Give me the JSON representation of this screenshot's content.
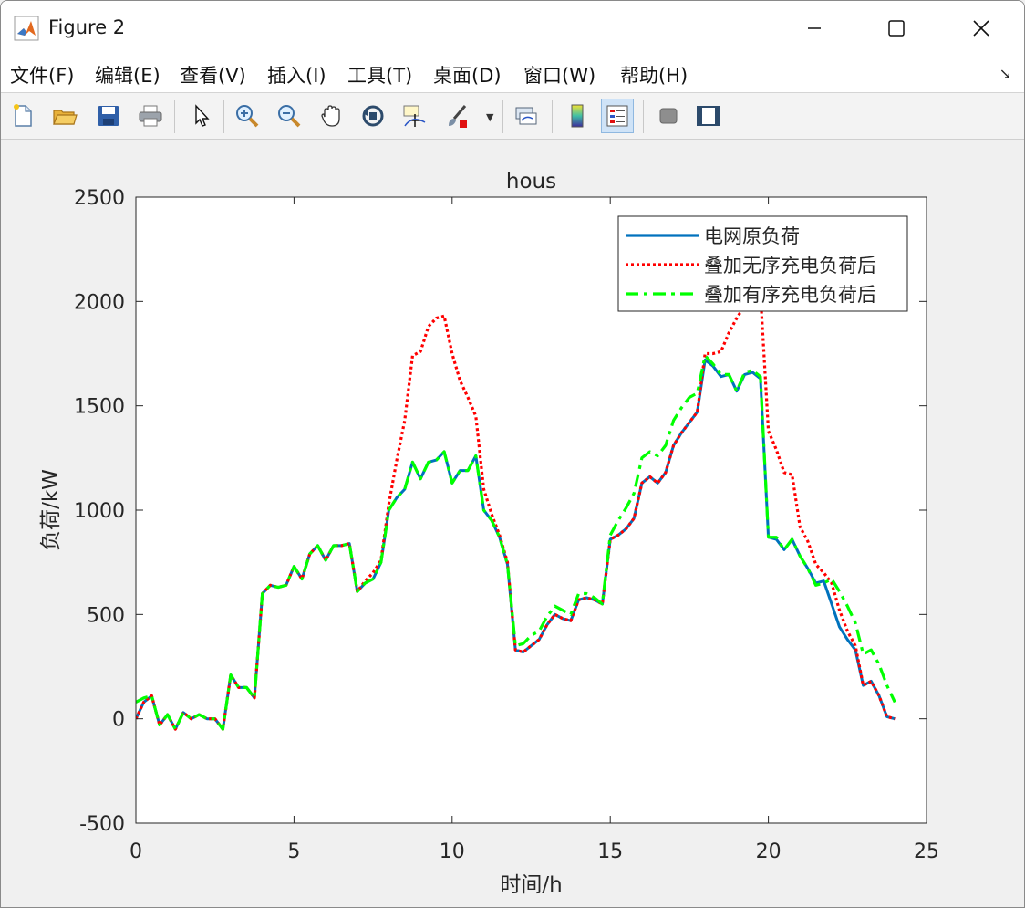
{
  "window": {
    "title": "Figure 2"
  },
  "menu": [
    "文件(F)",
    "编辑(E)",
    "查看(V)",
    "插入(I)",
    "工具(T)",
    "桌面(D)",
    "窗口(W)",
    "帮助(H)"
  ],
  "toolbar": [
    "new-file-icon",
    "open-folder-icon",
    "save-icon",
    "print-icon",
    "pointer-icon",
    "zoom-in-icon",
    "zoom-out-icon",
    "pan-hand-icon",
    "rotate-3d-icon",
    "data-cursor-icon",
    "brush-icon",
    "link-plot-icon",
    "colorbar-icon",
    "legend-icon",
    "hide-tools-icon",
    "dock-icon"
  ],
  "colors": {
    "series1": "#0072BD",
    "series2": "#FF0000",
    "series3": "#00FF00"
  },
  "chart_data": {
    "type": "line",
    "title": "hous",
    "xlabel": "时间/h",
    "ylabel": "负荷/kW",
    "xlim": [
      0,
      25
    ],
    "ylim": [
      -500,
      2500
    ],
    "xticks": [
      "0",
      "5",
      "10",
      "15",
      "20",
      "25"
    ],
    "yticks": [
      "-500",
      "0",
      "500",
      "1000",
      "1500",
      "2000",
      "2500"
    ],
    "grid": false,
    "legend_position": "top-right",
    "series": [
      {
        "name": "电网原负荷",
        "style": "solid",
        "points": [
          [
            0,
            0
          ],
          [
            0.25,
            80
          ],
          [
            0.5,
            110
          ],
          [
            0.75,
            -30
          ],
          [
            1,
            20
          ],
          [
            1.25,
            -50
          ],
          [
            1.5,
            30
          ],
          [
            1.75,
            0
          ],
          [
            2,
            20
          ],
          [
            2.25,
            0
          ],
          [
            2.5,
            0
          ],
          [
            2.75,
            -50
          ],
          [
            3,
            210
          ],
          [
            3.25,
            150
          ],
          [
            3.5,
            150
          ],
          [
            3.75,
            100
          ],
          [
            4,
            600
          ],
          [
            4.25,
            640
          ],
          [
            4.5,
            630
          ],
          [
            4.75,
            640
          ],
          [
            5,
            730
          ],
          [
            5.25,
            670
          ],
          [
            5.5,
            790
          ],
          [
            5.75,
            830
          ],
          [
            6,
            760
          ],
          [
            6.25,
            830
          ],
          [
            6.5,
            830
          ],
          [
            6.75,
            840
          ],
          [
            7,
            610
          ],
          [
            7.25,
            650
          ],
          [
            7.5,
            670
          ],
          [
            7.75,
            750
          ],
          [
            8,
            1000
          ],
          [
            8.25,
            1060
          ],
          [
            8.5,
            1100
          ],
          [
            8.75,
            1230
          ],
          [
            9,
            1150
          ],
          [
            9.25,
            1230
          ],
          [
            9.5,
            1240
          ],
          [
            9.75,
            1280
          ],
          [
            10,
            1130
          ],
          [
            10.25,
            1190
          ],
          [
            10.5,
            1190
          ],
          [
            10.75,
            1260
          ],
          [
            11,
            1000
          ],
          [
            11.25,
            950
          ],
          [
            11.5,
            870
          ],
          [
            11.75,
            740
          ],
          [
            12,
            330
          ],
          [
            12.25,
            320
          ],
          [
            12.5,
            350
          ],
          [
            12.75,
            380
          ],
          [
            13,
            450
          ],
          [
            13.25,
            500
          ],
          [
            13.5,
            480
          ],
          [
            13.75,
            470
          ],
          [
            14,
            570
          ],
          [
            14.25,
            580
          ],
          [
            14.5,
            570
          ],
          [
            14.75,
            550
          ],
          [
            15,
            860
          ],
          [
            15.25,
            880
          ],
          [
            15.5,
            910
          ],
          [
            15.75,
            960
          ],
          [
            16,
            1130
          ],
          [
            16.25,
            1160
          ],
          [
            16.5,
            1130
          ],
          [
            16.75,
            1180
          ],
          [
            17,
            1310
          ],
          [
            17.25,
            1370
          ],
          [
            17.5,
            1420
          ],
          [
            17.75,
            1470
          ],
          [
            18,
            1720
          ],
          [
            18.25,
            1690
          ],
          [
            18.5,
            1640
          ],
          [
            18.75,
            1650
          ],
          [
            19,
            1570
          ],
          [
            19.25,
            1650
          ],
          [
            19.5,
            1660
          ],
          [
            19.75,
            1630
          ],
          [
            20,
            870
          ],
          [
            20.25,
            860
          ],
          [
            20.5,
            810
          ],
          [
            20.75,
            860
          ],
          [
            21,
            780
          ],
          [
            21.25,
            720
          ],
          [
            21.5,
            650
          ],
          [
            21.75,
            660
          ],
          [
            22,
            550
          ],
          [
            22.25,
            440
          ],
          [
            22.5,
            380
          ],
          [
            22.75,
            330
          ],
          [
            23,
            160
          ],
          [
            23.25,
            180
          ],
          [
            23.5,
            110
          ],
          [
            23.75,
            10
          ],
          [
            24,
            0
          ]
        ]
      },
      {
        "name": "叠加无序充电负荷后",
        "style": "dotted",
        "points": [
          [
            0,
            0
          ],
          [
            0.25,
            80
          ],
          [
            0.5,
            110
          ],
          [
            0.75,
            -30
          ],
          [
            1,
            20
          ],
          [
            1.25,
            -50
          ],
          [
            1.5,
            30
          ],
          [
            1.75,
            0
          ],
          [
            2,
            20
          ],
          [
            2.25,
            0
          ],
          [
            2.5,
            0
          ],
          [
            2.75,
            -50
          ],
          [
            3,
            210
          ],
          [
            3.25,
            150
          ],
          [
            3.5,
            150
          ],
          [
            3.75,
            100
          ],
          [
            4,
            600
          ],
          [
            4.25,
            640
          ],
          [
            4.5,
            630
          ],
          [
            4.75,
            640
          ],
          [
            5,
            730
          ],
          [
            5.25,
            670
          ],
          [
            5.5,
            790
          ],
          [
            5.75,
            830
          ],
          [
            6,
            760
          ],
          [
            6.25,
            830
          ],
          [
            6.5,
            830
          ],
          [
            6.75,
            840
          ],
          [
            7,
            610
          ],
          [
            7.25,
            660
          ],
          [
            7.5,
            700
          ],
          [
            7.75,
            760
          ],
          [
            8,
            1030
          ],
          [
            8.25,
            1240
          ],
          [
            8.5,
            1430
          ],
          [
            8.75,
            1740
          ],
          [
            9,
            1760
          ],
          [
            9.25,
            1880
          ],
          [
            9.5,
            1920
          ],
          [
            9.75,
            1930
          ],
          [
            10,
            1750
          ],
          [
            10.25,
            1620
          ],
          [
            10.5,
            1540
          ],
          [
            10.75,
            1450
          ],
          [
            11,
            1100
          ],
          [
            11.25,
            980
          ],
          [
            11.5,
            880
          ],
          [
            11.75,
            750
          ],
          [
            12,
            330
          ],
          [
            12.25,
            320
          ],
          [
            12.5,
            350
          ],
          [
            12.75,
            380
          ],
          [
            13,
            450
          ],
          [
            13.25,
            500
          ],
          [
            13.5,
            480
          ],
          [
            13.75,
            470
          ],
          [
            14,
            570
          ],
          [
            14.25,
            580
          ],
          [
            14.5,
            570
          ],
          [
            14.75,
            550
          ],
          [
            15,
            860
          ],
          [
            15.25,
            880
          ],
          [
            15.5,
            910
          ],
          [
            15.75,
            960
          ],
          [
            16,
            1130
          ],
          [
            16.25,
            1160
          ],
          [
            16.5,
            1130
          ],
          [
            16.75,
            1180
          ],
          [
            17,
            1310
          ],
          [
            17.25,
            1370
          ],
          [
            17.5,
            1420
          ],
          [
            17.75,
            1470
          ],
          [
            18,
            1750
          ],
          [
            18.25,
            1750
          ],
          [
            18.5,
            1760
          ],
          [
            18.75,
            1850
          ],
          [
            19,
            1920
          ],
          [
            19.25,
            1980
          ],
          [
            19.5,
            2010
          ],
          [
            19.75,
            2040
          ],
          [
            20,
            1380
          ],
          [
            20.25,
            1290
          ],
          [
            20.5,
            1180
          ],
          [
            20.75,
            1170
          ],
          [
            21,
            920
          ],
          [
            21.25,
            850
          ],
          [
            21.5,
            740
          ],
          [
            21.75,
            700
          ],
          [
            22,
            650
          ],
          [
            22.25,
            520
          ],
          [
            22.5,
            420
          ],
          [
            22.75,
            350
          ],
          [
            23,
            160
          ],
          [
            23.25,
            180
          ],
          [
            23.5,
            110
          ],
          [
            23.75,
            10
          ],
          [
            24,
            0
          ]
        ]
      },
      {
        "name": "叠加有序充电负荷后",
        "style": "dashdot",
        "points": [
          [
            0,
            80
          ],
          [
            0.25,
            100
          ],
          [
            0.5,
            110
          ],
          [
            0.75,
            -30
          ],
          [
            1,
            20
          ],
          [
            1.25,
            -50
          ],
          [
            1.5,
            30
          ],
          [
            1.75,
            0
          ],
          [
            2,
            20
          ],
          [
            2.25,
            0
          ],
          [
            2.5,
            0
          ],
          [
            2.75,
            -50
          ],
          [
            3,
            210
          ],
          [
            3.25,
            150
          ],
          [
            3.5,
            150
          ],
          [
            3.75,
            100
          ],
          [
            4,
            600
          ],
          [
            4.25,
            640
          ],
          [
            4.5,
            630
          ],
          [
            4.75,
            640
          ],
          [
            5,
            730
          ],
          [
            5.25,
            670
          ],
          [
            5.5,
            790
          ],
          [
            5.75,
            830
          ],
          [
            6,
            760
          ],
          [
            6.25,
            830
          ],
          [
            6.5,
            830
          ],
          [
            6.75,
            840
          ],
          [
            7,
            610
          ],
          [
            7.25,
            650
          ],
          [
            7.5,
            670
          ],
          [
            7.75,
            750
          ],
          [
            8,
            1000
          ],
          [
            8.25,
            1060
          ],
          [
            8.5,
            1100
          ],
          [
            8.75,
            1230
          ],
          [
            9,
            1150
          ],
          [
            9.25,
            1230
          ],
          [
            9.5,
            1240
          ],
          [
            9.75,
            1280
          ],
          [
            10,
            1130
          ],
          [
            10.25,
            1190
          ],
          [
            10.5,
            1190
          ],
          [
            10.75,
            1260
          ],
          [
            11,
            1000
          ],
          [
            11.25,
            950
          ],
          [
            11.5,
            870
          ],
          [
            11.75,
            740
          ],
          [
            12,
            350
          ],
          [
            12.25,
            360
          ],
          [
            12.5,
            400
          ],
          [
            12.75,
            420
          ],
          [
            13,
            490
          ],
          [
            13.25,
            540
          ],
          [
            13.5,
            520
          ],
          [
            13.75,
            500
          ],
          [
            14,
            600
          ],
          [
            14.25,
            600
          ],
          [
            14.5,
            580
          ],
          [
            14.75,
            550
          ],
          [
            15,
            880
          ],
          [
            15.25,
            950
          ],
          [
            15.5,
            1010
          ],
          [
            15.75,
            1080
          ],
          [
            16,
            1250
          ],
          [
            16.25,
            1280
          ],
          [
            16.5,
            1260
          ],
          [
            16.75,
            1310
          ],
          [
            17,
            1430
          ],
          [
            17.25,
            1490
          ],
          [
            17.5,
            1540
          ],
          [
            17.75,
            1560
          ],
          [
            18,
            1740
          ],
          [
            18.25,
            1700
          ],
          [
            18.5,
            1650
          ],
          [
            18.75,
            1650
          ],
          [
            19,
            1570
          ],
          [
            19.25,
            1660
          ],
          [
            19.5,
            1670
          ],
          [
            19.75,
            1640
          ],
          [
            20,
            870
          ],
          [
            20.25,
            870
          ],
          [
            20.5,
            810
          ],
          [
            20.75,
            860
          ],
          [
            21,
            780
          ],
          [
            21.25,
            720
          ],
          [
            21.5,
            640
          ],
          [
            21.75,
            650
          ],
          [
            22,
            670
          ],
          [
            22.25,
            610
          ],
          [
            22.5,
            540
          ],
          [
            22.75,
            460
          ],
          [
            23,
            310
          ],
          [
            23.25,
            330
          ],
          [
            23.5,
            260
          ],
          [
            23.75,
            160
          ],
          [
            24,
            80
          ]
        ]
      }
    ]
  }
}
